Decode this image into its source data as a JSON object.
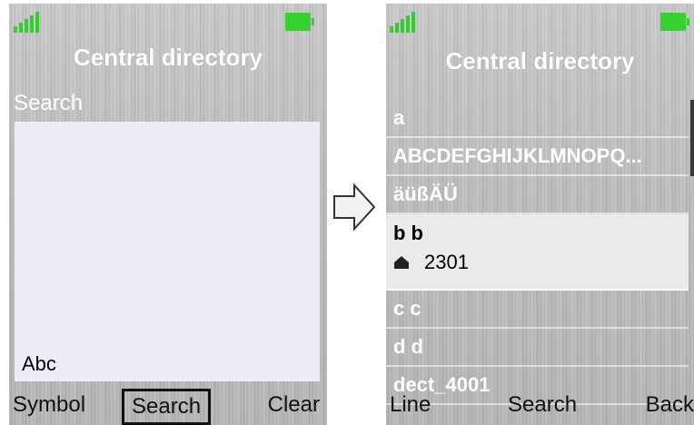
{
  "left_screen": {
    "title": "Central directory",
    "search_label": "Search",
    "input_mode": "Abc",
    "softkeys": {
      "left": "Symbol",
      "middle": "Search",
      "right": "Clear"
    }
  },
  "right_screen": {
    "title": "Central directory",
    "entries_before": [
      "a",
      "ABCDEFGHIJKLMNOPQ...",
      "äüßÄÜ"
    ],
    "selected": {
      "name": "b b",
      "number": "2301",
      "number_icon": "house-icon"
    },
    "entries_after": [
      "c c",
      "d d",
      "dect_4001"
    ],
    "softkeys": {
      "left": "Line",
      "middle": "Search",
      "right": "Back"
    }
  },
  "colors": {
    "signal": "#2fd02a",
    "battery": "#35d12d",
    "input_bg": "#f0ecf7"
  },
  "icons": [
    "signal-strength-icon",
    "battery-icon",
    "right-arrow-icon",
    "house-icon"
  ]
}
